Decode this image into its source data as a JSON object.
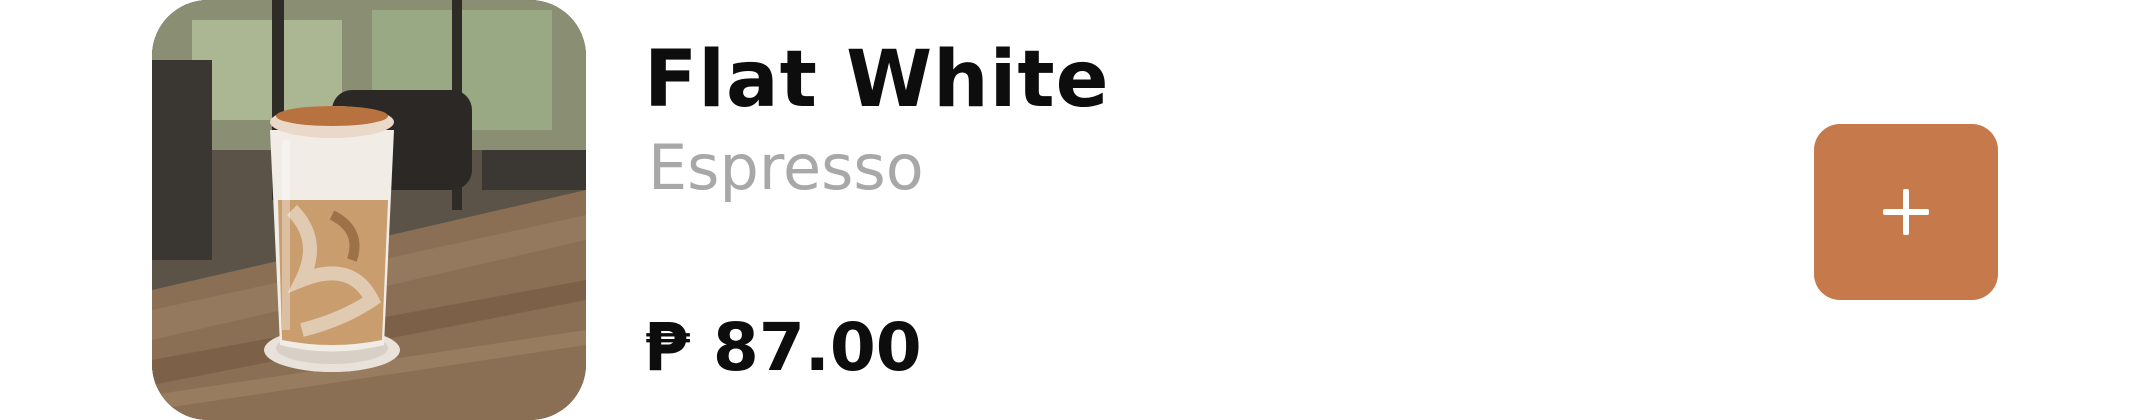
{
  "product": {
    "name": "Flat White",
    "category": "Espresso",
    "price": "₱ 87.00",
    "image": "iced-latte-glass-photo"
  },
  "actions": {
    "add_icon": "plus-icon"
  },
  "colors": {
    "accent": "#c67a4c",
    "title": "#0d0d0d",
    "subtitle": "#a8a8a8"
  }
}
